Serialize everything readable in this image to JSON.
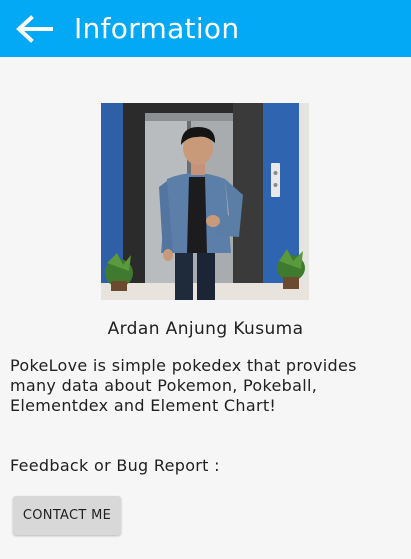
{
  "appbar": {
    "back_icon": "arrow-left-icon",
    "title": "Information",
    "color": "#03a9f4"
  },
  "profile": {
    "name": "Ardan Anjung Kusuma"
  },
  "description": "PokeLove is simple pokedex that provides many data about Pokemon, Pokeball, Elementdex and Element Chart!",
  "feedback": {
    "label": "Feedback or Bug Report :",
    "button_label": "CONTACT ME"
  }
}
